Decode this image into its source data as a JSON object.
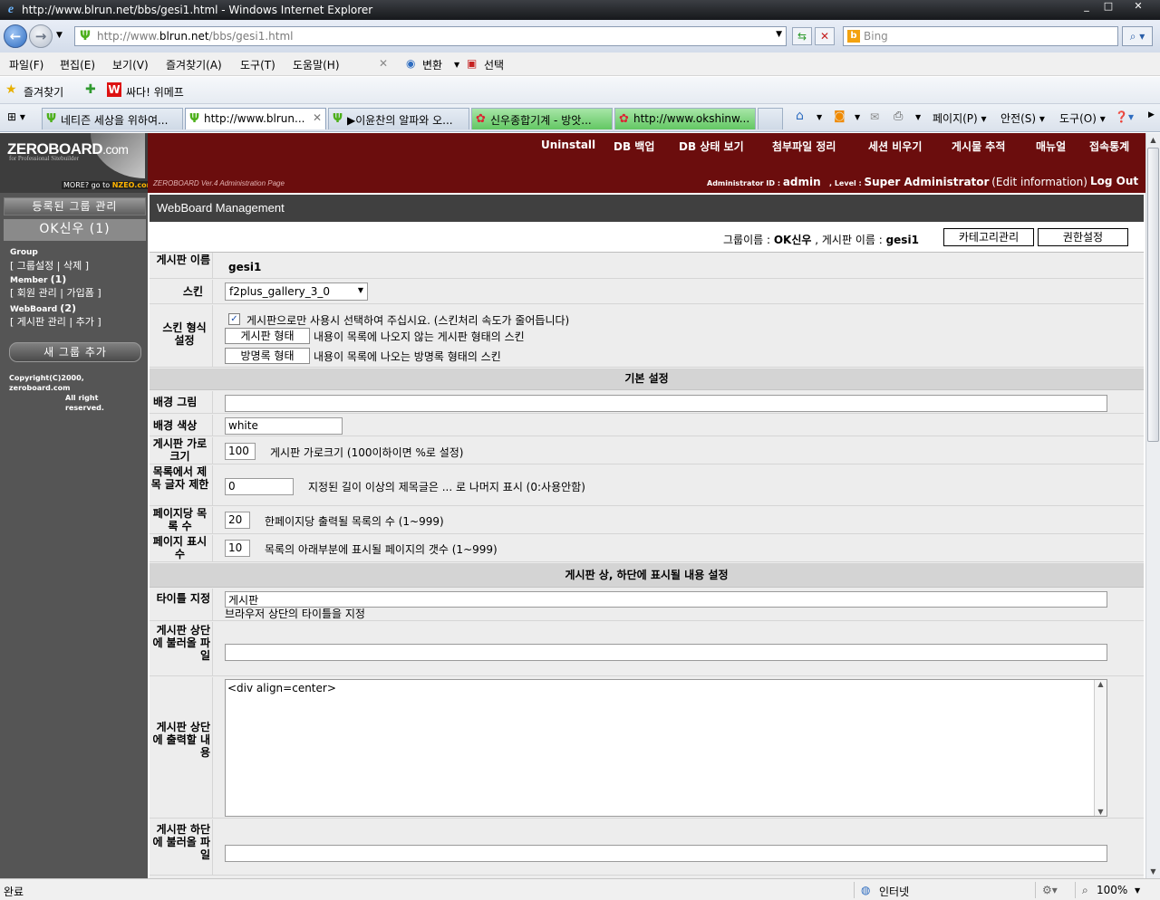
{
  "window": {
    "title": "http://www.blrun.net/bbs/gesi1.html - Windows Internet Explorer",
    "min_label": "_",
    "max_label": "□",
    "close_label": "✕"
  },
  "address": {
    "url_prefix": "http://www.",
    "url_domain": "blrun.net",
    "url_path": "/bbs/gesi1.html",
    "search_placeholder": "Bing"
  },
  "menu": [
    "파일(F)",
    "편집(E)",
    "보기(V)",
    "즐겨찾기(A)",
    "도구(T)",
    "도움말(H)"
  ],
  "menu_extra": {
    "convert": "변환",
    "select": "선택"
  },
  "favorites": {
    "label": "즐겨찾기",
    "item": "싸다! 위메프"
  },
  "tabs": [
    {
      "label": "네티즌 세상을 위하여...",
      "icon": "sprout-icon"
    },
    {
      "label": "http://www.blrun...",
      "icon": "sprout-icon",
      "active": true
    },
    {
      "label": "▶이윤찬의 알파와 오...",
      "icon": "sprout-icon"
    },
    {
      "label": "신우종합기계 - 방앗...",
      "icon": "flower-icon",
      "green": true
    },
    {
      "label": "http://www.okshinw...",
      "icon": "flower-icon",
      "green": true
    }
  ],
  "toolbar": {
    "page": "페이지(P)",
    "safety": "안전(S)",
    "tools": "도구(O)"
  },
  "left": {
    "logo_main": "ZEROBOARD",
    "logo_suffix": ".com",
    "logo_sub": "for Professional Sitebuilder",
    "logo_more": "MORE? go to ",
    "logo_more_link": "NZEO.com",
    "group_title": "등록된 그룹 관리",
    "group_name": "OK신우 (1)",
    "group_label": "Group",
    "group_links": "[ 그룹설정 | 삭제 ]",
    "member_label": "Member",
    "member_count": "(1)",
    "member_links": "[ 회원 관리 | 가입폼 ]",
    "webboard_label": "WebBoard",
    "webboard_count": "(2)",
    "webboard_links": "[ 게시판 관리 | 추가 ]",
    "new_group": "새 그룹 추가",
    "copyright1": "Copyright(C)2000, zeroboard.com",
    "copyright2": "All right reserved."
  },
  "top": {
    "menu": [
      "Uninstall",
      "DB 백업",
      "DB 상태 보기",
      "첨부파일 정리",
      "세션 비우기",
      "게시물 추적",
      "매뉴얼",
      "접속통계"
    ],
    "version": "ZEROBOARD Ver.4 Administration Page",
    "admin_label": "Administrator ID : ",
    "admin_id": "admin",
    "level_label": ", Level : ",
    "level_value": "Super Administrator",
    "edit_info": "(Edit information)",
    "logout": "Log Out"
  },
  "section_title": "WebBoard Management",
  "info": {
    "group_label": "그룹이름 : ",
    "group_value": "OK신우",
    "board_label": " , 게시판 이름 : ",
    "board_value": "gesi1",
    "category_btn": "카테고리관리",
    "permission_btn": "권한설정"
  },
  "form": {
    "board_name_label": "게시판 이름",
    "board_name_value": "gesi1",
    "skin_label": "스킨",
    "skin_value": "f2plus_gallery_3_0",
    "skin_type_label": "스킨 형식 설정",
    "skin_type_note": "게시판으로만 사용시 선택하여 주십시요. (스킨처리 속도가 줄어듭니다)",
    "skin_type_board_btn": "게시판 형태",
    "skin_type_board_desc": "내용이 목록에 나오지 않는 게시판 형태의 스킨",
    "skin_type_guest_btn": "방명록 형태",
    "skin_type_guest_desc": "내용이 목록에 나오는 방명록 형태의 스킨",
    "basic_section": "기본 설정",
    "bg_image_label": "배경 그림",
    "bg_color_label": "배경 색상",
    "bg_color_value": "white",
    "width_label": "게시판 가로 크기",
    "width_value": "100",
    "width_desc": "게시판 가로크기 (100이하이면 %로 설정)",
    "title_len_label": "목록에서 제목 글자 제한",
    "title_len_value": "0",
    "title_len_desc": "지정된 길이 이상의 제목글은 ... 로 나머지 표시 (0:사용안함)",
    "per_page_label": "페이지당 목록 수",
    "per_page_value": "20",
    "per_page_desc": "한페이지당 출력될 목록의 수 (1~999)",
    "page_count_label": "페이지 표시 수",
    "page_count_value": "10",
    "page_count_desc": "목록의 아래부분에 표시될 페이지의 갯수 (1~999)",
    "header_section": "게시판 상, 하단에 표시될 내용 설정",
    "title_set_label": "타이틀 지정",
    "title_set_value": "게시판",
    "title_set_desc": "브라우저 상단의 타이틀을 지정",
    "header_file_label": "게시판 상단에 불러올 파일",
    "header_html_label": "게시판 상단에 출력할 내용",
    "header_html_value": "<div align=center>",
    "footer_file_label": "게시판 하단에 불러올 파일"
  },
  "status": {
    "done": "완료",
    "zone": "인터넷",
    "zoom": "100%"
  }
}
